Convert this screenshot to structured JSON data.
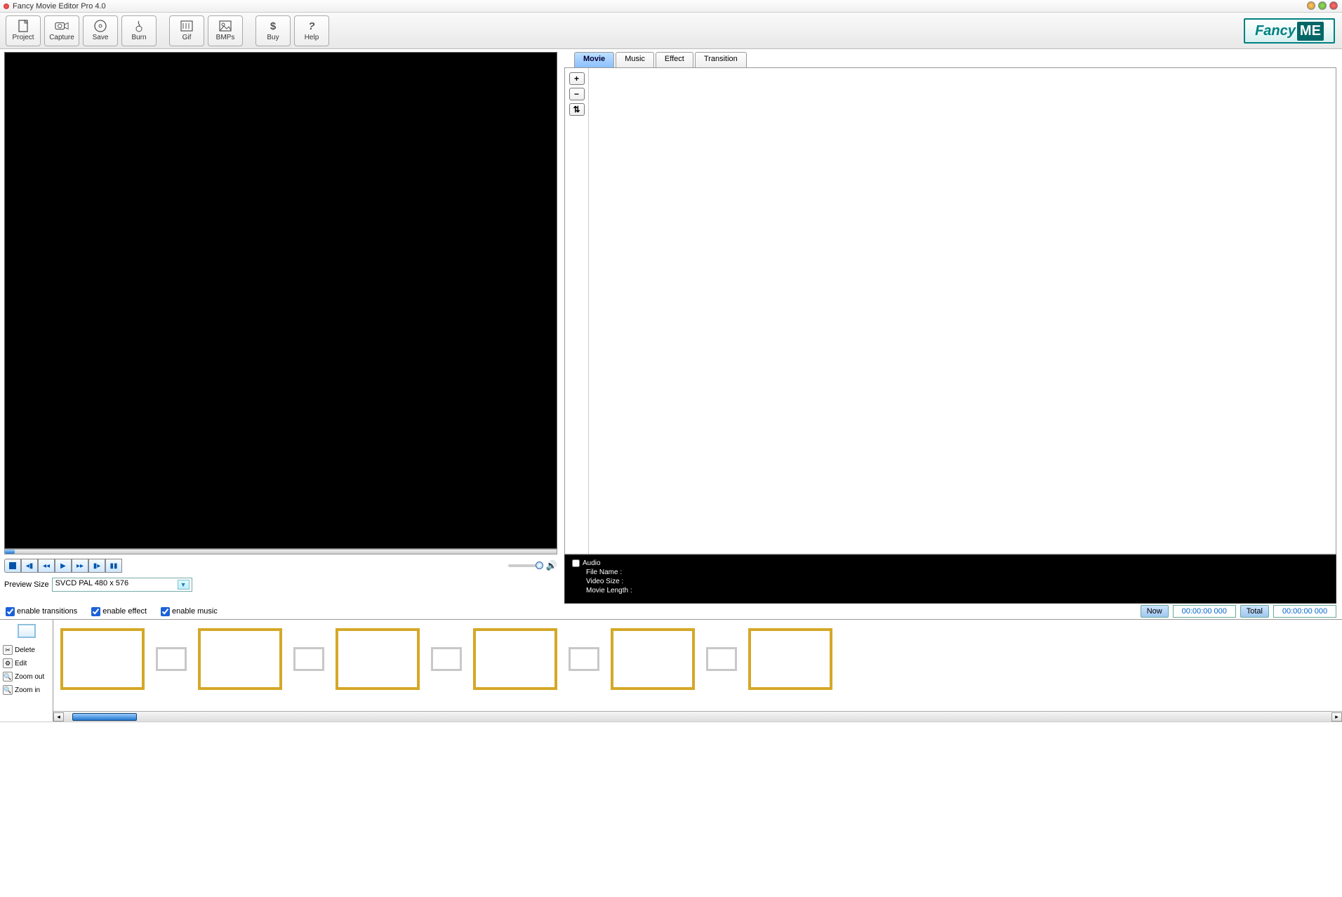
{
  "app": {
    "title": "Fancy Movie Editor Pro 4.0",
    "logo_main": "Fancy",
    "logo_suffix": "ME"
  },
  "toolbar": {
    "project": "Project",
    "capture": "Capture",
    "save": "Save",
    "burn": "Burn",
    "gif": "Gif",
    "bmps": "BMPs",
    "buy": "Buy",
    "help": "Help"
  },
  "tabs": {
    "movie": "Movie",
    "music": "Music",
    "effect": "Effect",
    "transition": "Transition"
  },
  "panel_tools": {
    "plus": "+",
    "minus": "−",
    "updown": "⇅"
  },
  "info": {
    "audio_label": "Audio",
    "file_name_label": "File Name :",
    "video_size_label": "Video Size :",
    "movie_length_label": "Movie Length :"
  },
  "preview_size": {
    "label": "Preview Size",
    "value": "SVCD PAL 480 x 576"
  },
  "checks": {
    "transitions": "enable transitions",
    "effect": "enable effect",
    "music": "enable music"
  },
  "time": {
    "now_label": "Now",
    "now_value": "00:00:00 000",
    "total_label": "Total",
    "total_value": "00:00:00 000"
  },
  "tl_tools": {
    "delete": "Delete",
    "edit": "Edit",
    "zoom_out": "Zoom out",
    "zoom_in": "Zoom in"
  }
}
